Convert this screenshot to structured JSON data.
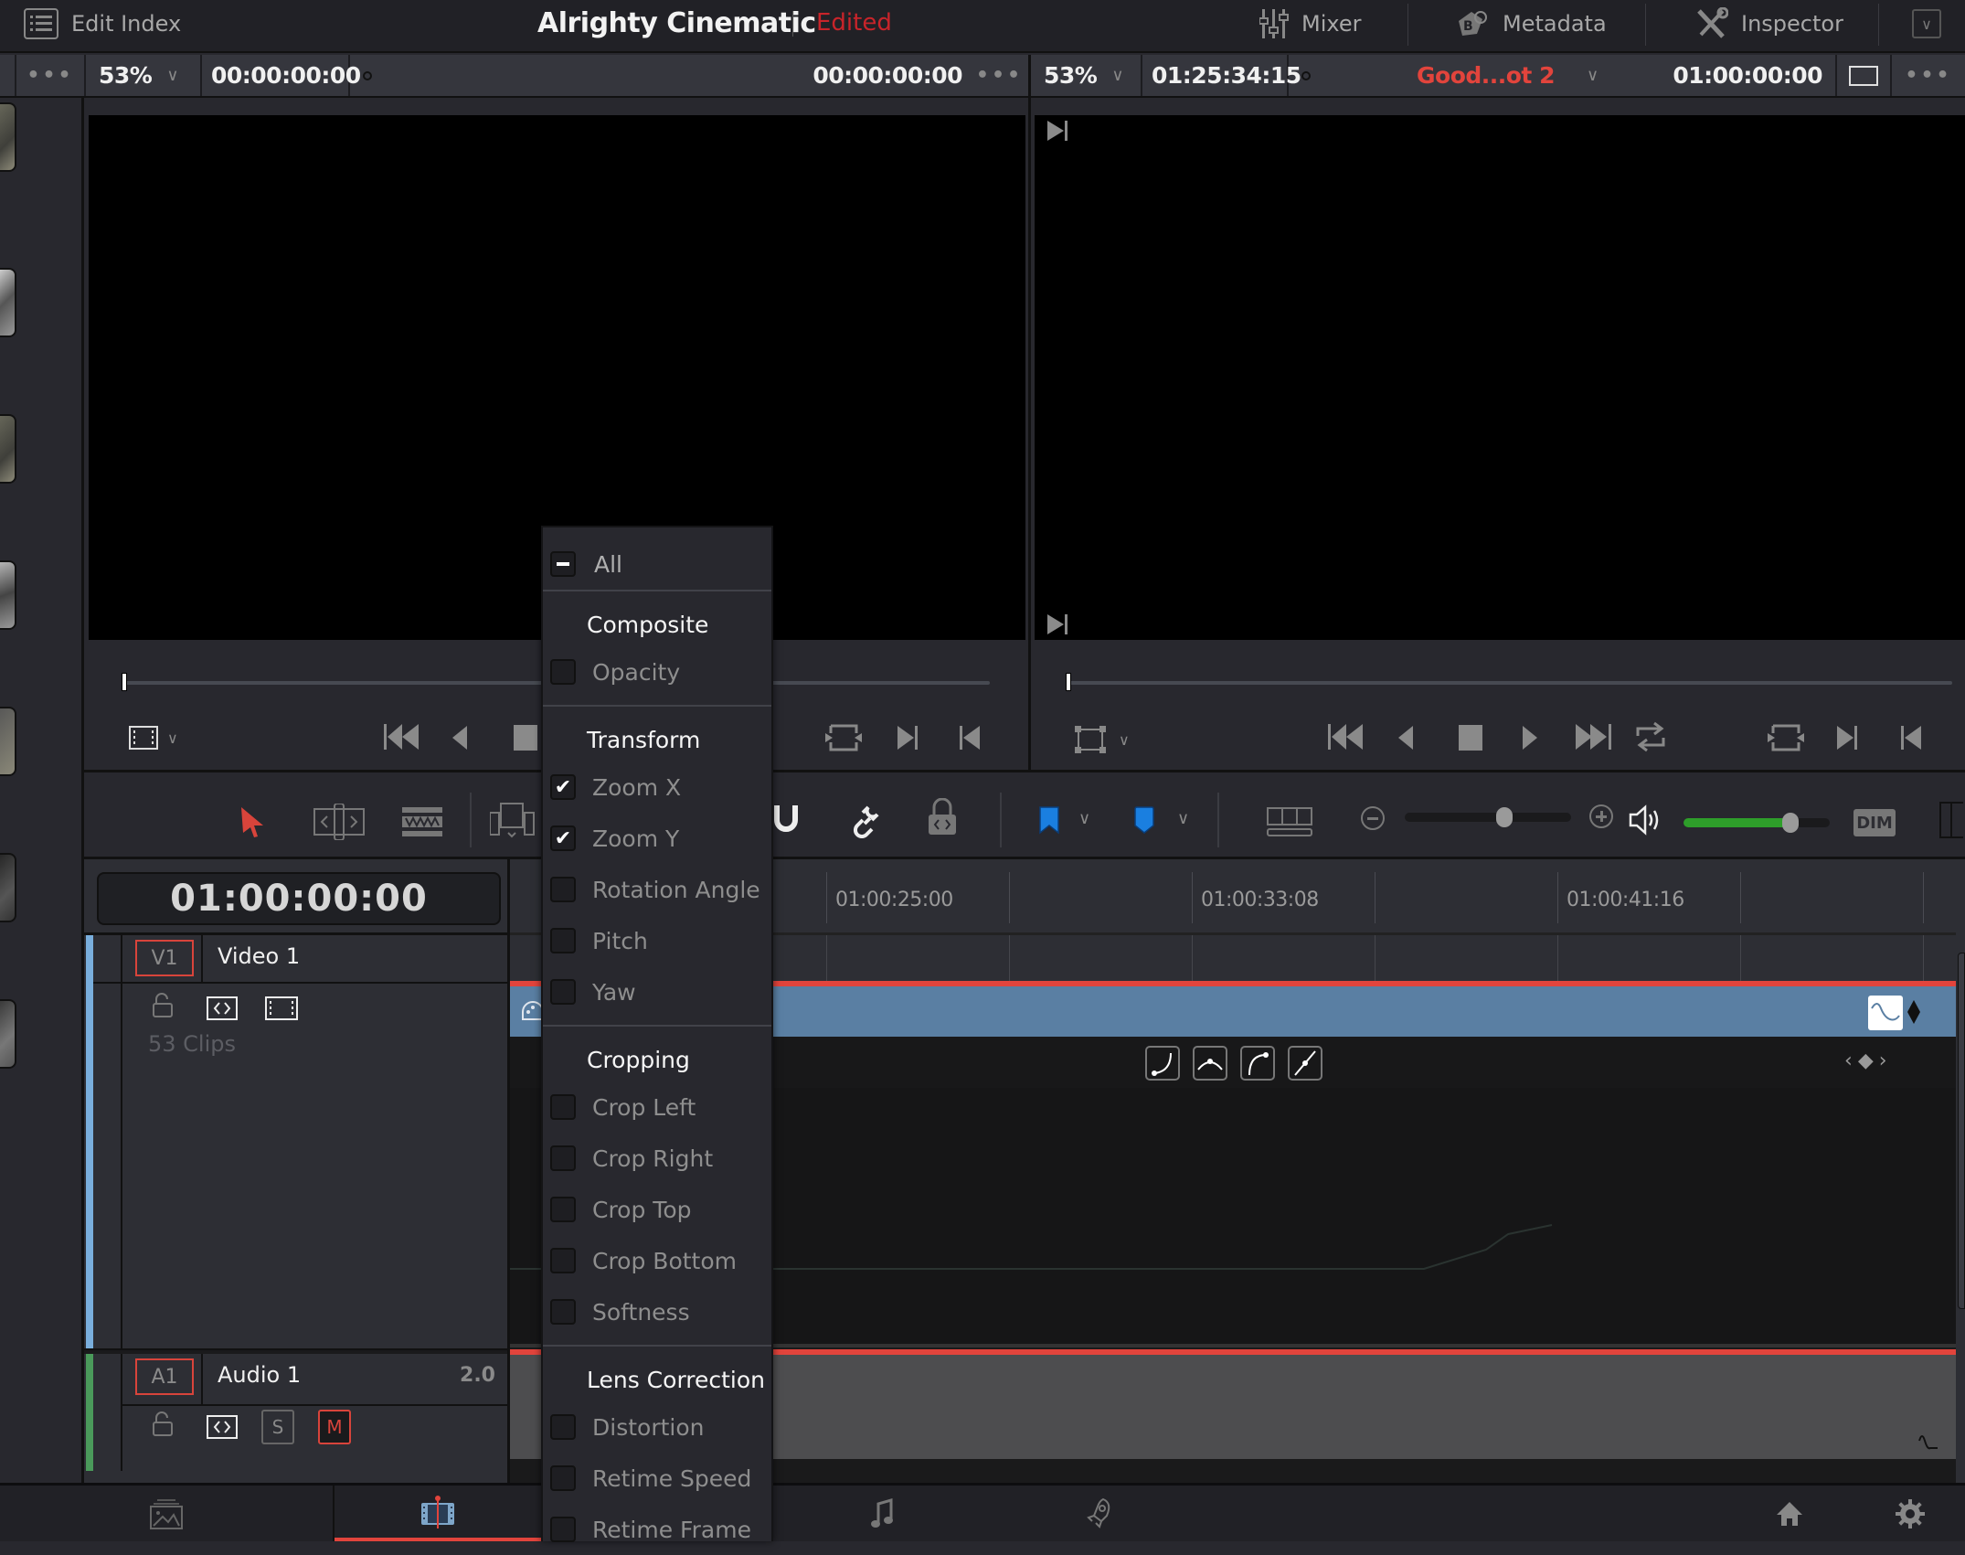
{
  "topbar": {
    "edit_index_label": "Edit Index",
    "project_title": "Alrighty Cinematic",
    "project_status": "Edited",
    "mixer_label": "Mixer",
    "metadata_label": "Metadata",
    "inspector_label": "Inspector"
  },
  "source_viewer": {
    "options_label": "•••",
    "zoom": "53%",
    "timecode_left": "00:00:00:00",
    "timecode_right": "00:00:00:00",
    "more_label": "•••"
  },
  "timeline_viewer": {
    "zoom": "53%",
    "duration": "01:25:34:15",
    "timeline_name": "Good...ot 2",
    "timecode": "01:00:00:00",
    "more_label": "•••"
  },
  "timeline": {
    "current_timecode": "01:00:00:00",
    "ruler_labels": [
      "01:00:25:00",
      "01:00:33:08",
      "01:00:41:16"
    ],
    "tracks": {
      "video": {
        "id": "V1",
        "name": "Video 1",
        "clip_count": "53 Clips"
      },
      "audio": {
        "id": "A1",
        "name": "Audio 1",
        "channels": "2.0",
        "solo": "S",
        "mute": "M"
      }
    },
    "zoom_slider_fraction": 0.6,
    "volume_fraction": 0.73,
    "dim_label": "DIM"
  },
  "keyframe_menu": {
    "all_label": "All",
    "all_state": "partial",
    "sections": [
      {
        "title": "Composite",
        "items": [
          {
            "label": "Opacity",
            "checked": false
          }
        ]
      },
      {
        "title": "Transform",
        "items": [
          {
            "label": "Zoom X",
            "checked": true
          },
          {
            "label": "Zoom Y",
            "checked": true
          },
          {
            "label": "Rotation Angle",
            "checked": false
          },
          {
            "label": "Pitch",
            "checked": false
          },
          {
            "label": "Yaw",
            "checked": false
          }
        ]
      },
      {
        "title": "Cropping",
        "items": [
          {
            "label": "Crop Left",
            "checked": false
          },
          {
            "label": "Crop Right",
            "checked": false
          },
          {
            "label": "Crop Top",
            "checked": false
          },
          {
            "label": "Crop Bottom",
            "checked": false
          },
          {
            "label": "Softness",
            "checked": false
          }
        ]
      },
      {
        "title": "Lens Correction",
        "items": [
          {
            "label": "Distortion",
            "checked": false
          },
          {
            "label": "Retime Speed",
            "checked": false
          },
          {
            "label": "Retime Frame",
            "checked": false
          }
        ]
      }
    ]
  },
  "colors": {
    "accent_red": "#d8443b",
    "edited_red": "#c8242a",
    "clip_blue": "#5a7fa3",
    "flag_blue": "#1a7fe0",
    "volume_green": "#2e9e2a",
    "video_track_stripe": "#79aedc",
    "audio_track_stripe": "#4a9a5a"
  }
}
